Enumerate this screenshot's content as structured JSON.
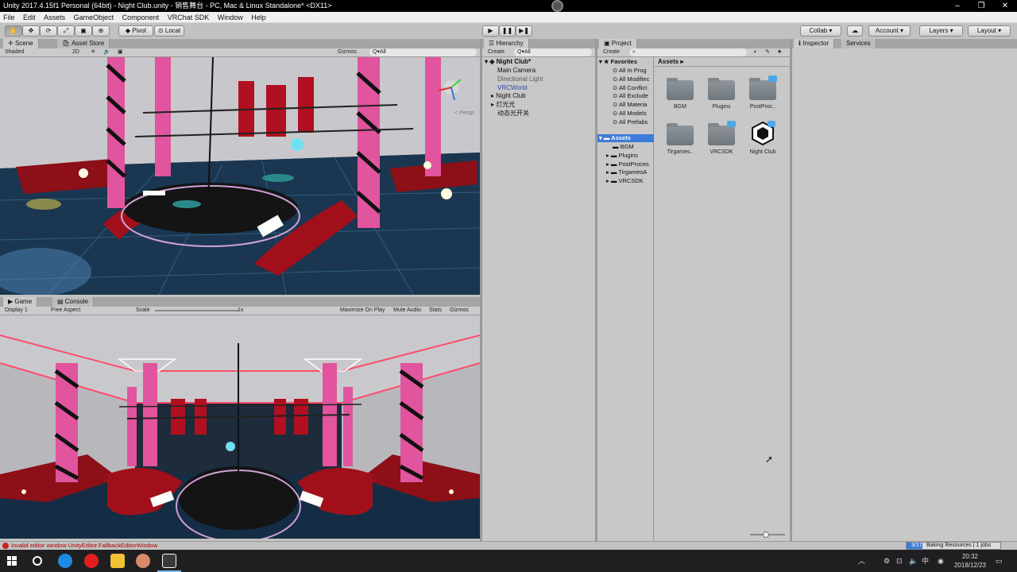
{
  "window": {
    "title": "Unity 2017.4.15f1 Personal (64bit) - Night Club.unity - 销售舞台 - PC, Mac & Linux Standalone* <DX11>",
    "controls": [
      "–",
      "❐",
      "✕"
    ]
  },
  "menu": [
    "File",
    "Edit",
    "Assets",
    "GameObject",
    "Component",
    "VRChat SDK",
    "Window",
    "Help"
  ],
  "toolbar": {
    "pivot_label": "Pivot",
    "local_label": "Local",
    "collab_label": "Collab ▾",
    "account_label": "Account",
    "layers_label": "Layers",
    "layout_label": "Layout"
  },
  "scene": {
    "tab_label": "Scene",
    "asset_store_tab": "Asset Store",
    "shading_mode": "Shaded",
    "mode_2d": "2D",
    "gizmos_label": "Gizmos",
    "search_placeholder": "Q▾All",
    "persp_label": "< Persp"
  },
  "game": {
    "tab_label": "Game",
    "console_tab": "Console",
    "display": "Display 1",
    "aspect": "Free Aspect",
    "scale_label": "Scale",
    "scale_value": "1x",
    "maximize_on_play": "Maximize On Play",
    "mute_audio": "Mute Audio",
    "stats": "Stats",
    "gizmos_label": "Gizmos"
  },
  "hierarchy": {
    "tab_label": "Hierarchy",
    "create_label": "Create",
    "search_placeholder": "Q▾All",
    "scene_name": "Night Club*",
    "items": [
      {
        "label": "Main Camera",
        "color": "#111111"
      },
      {
        "label": "Directional Light",
        "color": "#5a5a5a"
      },
      {
        "label": "VRCWorld",
        "color": "#2a47a8"
      },
      {
        "label": "Night Club",
        "color": "#111111"
      },
      {
        "label": "灯光光",
        "color": "#111111"
      },
      {
        "label": "动态光开关",
        "color": "#111111"
      }
    ]
  },
  "project": {
    "tab_label": "Project",
    "create_label": "Create",
    "breadcrumb": "Assets ▸",
    "favorites_label": "Favorites",
    "favorites": [
      "All In Prog",
      "All Modifiec",
      "All Conflict",
      "All Exclude",
      "All Materia",
      "All Models",
      "All Prefabs"
    ],
    "assets_label": "Assets",
    "asset_tree": [
      "BGM",
      "Plugins",
      "PostProces",
      "TirgamesA",
      "VRCSDK"
    ],
    "grid_items": [
      {
        "label": "BGM",
        "kind": "folder"
      },
      {
        "label": "Plugins",
        "kind": "folder"
      },
      {
        "label": "PostProc..",
        "kind": "folder"
      },
      {
        "label": "Tirgames..",
        "kind": "folder"
      },
      {
        "label": "VRCSDK",
        "kind": "folder"
      },
      {
        "label": "Night Club",
        "kind": "unity-scene"
      }
    ]
  },
  "inspector": {
    "tab_label": "Inspector",
    "services_tab": "Services"
  },
  "status": {
    "error_message": "Invalid editor window UnityEditor.FallbackEditorWindow",
    "baking_progress": "3/17",
    "baking_label": "Baking Resources | 1 jobs"
  },
  "taskbar": {
    "time": "20:32",
    "date": "2018/12/23"
  },
  "colors": {
    "editor_bg": "#c2c2c2",
    "scene_floor": "#1b3650",
    "neon_pink": "#e0559d",
    "sofa_red": "#9a0f17",
    "accent_blue": "#3d7bd9"
  }
}
